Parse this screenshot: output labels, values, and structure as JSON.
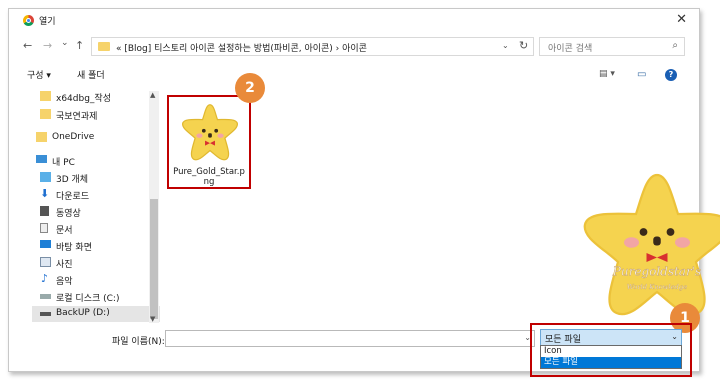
{
  "window": {
    "title": "열기",
    "close_glyph": "✕"
  },
  "nav": {
    "back": "←",
    "forward": "→",
    "recent": "⌄",
    "up": "↑"
  },
  "address": {
    "path": "« [Blog] 티스토리 아이콘 설정하는 방법(파비콘, 아이콘)  ›  아이콘",
    "refresh": "↻"
  },
  "search": {
    "placeholder": "아이콘 검색"
  },
  "toolbar": {
    "organize": "구성 ▾",
    "new_folder": "새 폴더",
    "view_glyph": "▤ ▾",
    "pane_glyph": "▭",
    "help": "?"
  },
  "sidebar": {
    "items": [
      {
        "label": "x64dbg_작성",
        "icon": "folder-icon"
      },
      {
        "label": "국보연과제",
        "icon": "folder-icon"
      },
      {
        "label": "OneDrive",
        "icon": "folder-icon"
      },
      {
        "label": "내 PC",
        "icon": "pc-icon"
      },
      {
        "label": "3D 개체",
        "icon": "3d-objects-icon"
      },
      {
        "label": "다운로드",
        "icon": "download-icon"
      },
      {
        "label": "동영상",
        "icon": "video-icon"
      },
      {
        "label": "문서",
        "icon": "document-icon"
      },
      {
        "label": "바탕 화면",
        "icon": "desktop-icon"
      },
      {
        "label": "사진",
        "icon": "pictures-icon"
      },
      {
        "label": "음악",
        "icon": "music-icon"
      },
      {
        "label": "로컬 디스크 (C:)",
        "icon": "drive-icon"
      },
      {
        "label": "BackUP (D:)",
        "icon": "drive-icon"
      }
    ]
  },
  "files": [
    {
      "name_line1": "Pure_Gold_Star.p",
      "name_line2": "ng"
    }
  ],
  "preview": {
    "watermark_line1": "Puregoldstar's",
    "watermark_line2": "World Knowledge"
  },
  "badges": {
    "one": "1",
    "two": "2"
  },
  "bottom": {
    "filename_label": "파일 이름(N):",
    "filename_value": "",
    "filetype_selected": "모든 파일",
    "filetype_options": [
      "Icon",
      "모든 파일"
    ]
  },
  "colors": {
    "accent": "#0078d7",
    "highlight": "#c00000",
    "badge": "#e98a3a",
    "star": "#f5d34f"
  }
}
